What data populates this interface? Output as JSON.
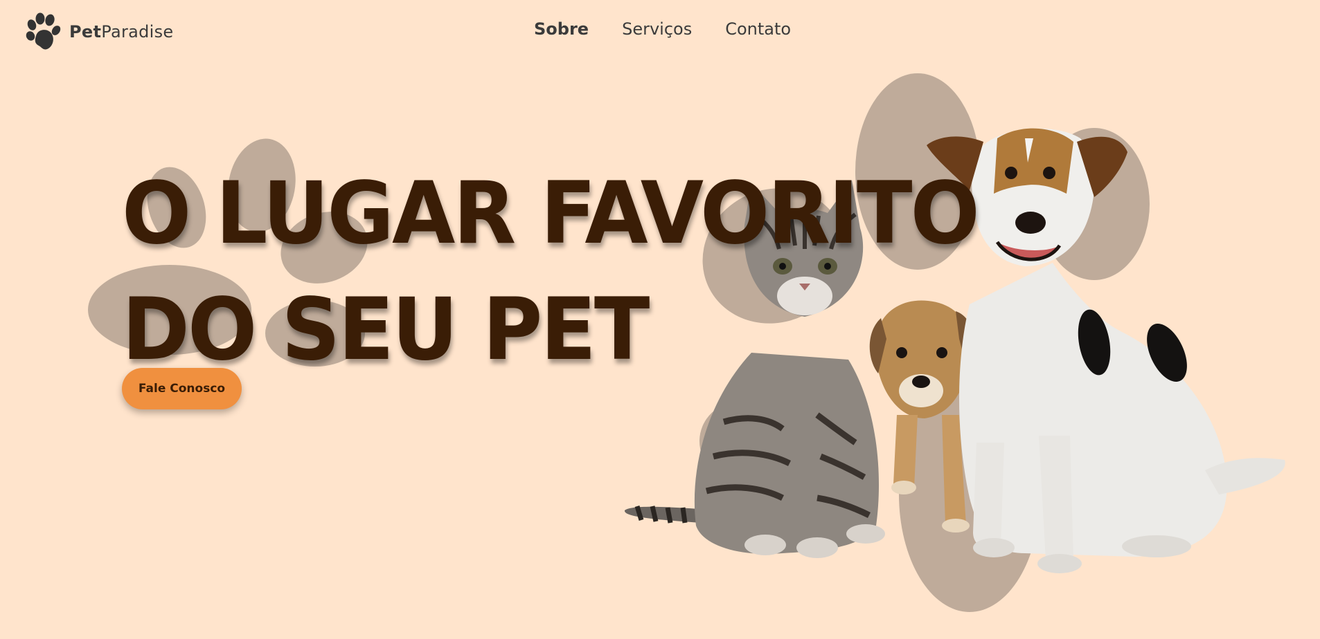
{
  "header": {
    "logo_text_bold": "Pet",
    "logo_text_light": "Paradise",
    "nav": [
      {
        "label": "Sobre",
        "active": true
      },
      {
        "label": "Serviços",
        "active": false
      },
      {
        "label": "Contato",
        "active": false
      }
    ]
  },
  "hero": {
    "headline_line1": "O LUGAR FAVORITO",
    "headline_line2": "DO SEU PET",
    "cta_label": "Fale Conosco"
  },
  "colors": {
    "background": "#ffe4cc",
    "headline": "#3a1d06",
    "cta": "#f0903f",
    "paw": "#bfab9a",
    "nav_text": "#3b3b3b"
  },
  "icons": {
    "logo": "paw-icon"
  }
}
